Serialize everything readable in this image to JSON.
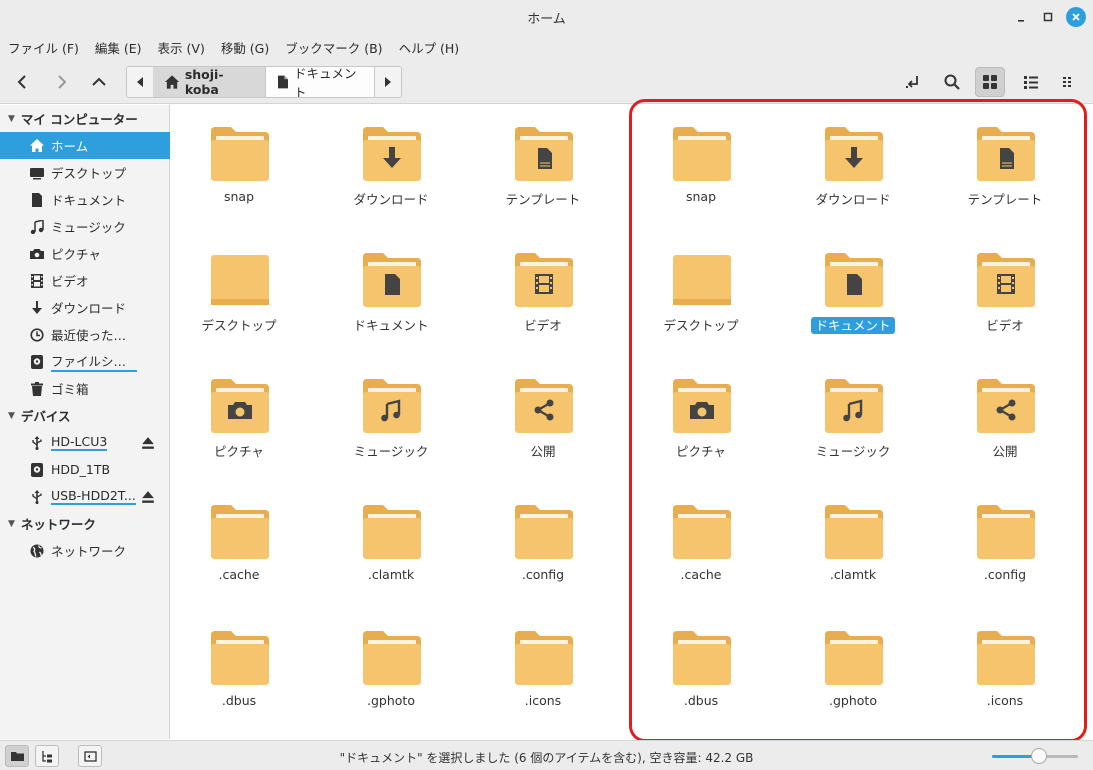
{
  "window": {
    "title": "ホーム"
  },
  "menu": [
    "ファイル (F)",
    "編集 (E)",
    "表示 (V)",
    "移動 (G)",
    "ブックマーク (B)",
    "ヘルプ (H)"
  ],
  "path": {
    "home": "shoji-koba",
    "doc": "ドキュメント"
  },
  "sidebar": {
    "sections": [
      {
        "title": "マイ コンピューター"
      },
      {
        "title": "デバイス"
      },
      {
        "title": "ネットワーク"
      }
    ],
    "computer": [
      {
        "label": "ホーム",
        "icon": "home-icon"
      },
      {
        "label": "デスクトップ",
        "icon": "desktop-icon"
      },
      {
        "label": "ドキュメント",
        "icon": "document-icon"
      },
      {
        "label": "ミュージック",
        "icon": "music-icon"
      },
      {
        "label": "ピクチャ",
        "icon": "camera-icon"
      },
      {
        "label": "ビデオ",
        "icon": "film-icon"
      },
      {
        "label": "ダウンロード",
        "icon": "download-icon"
      },
      {
        "label": "最近使ったフ...",
        "icon": "clock-icon"
      },
      {
        "label": "ファイルシス...",
        "icon": "drive-icon"
      },
      {
        "label": "ゴミ箱",
        "icon": "trash-icon"
      }
    ],
    "devices": [
      {
        "label": "HD-LCU3",
        "icon": "usb-icon"
      },
      {
        "label": "HDD_1TB",
        "icon": "drive-icon"
      },
      {
        "label": "USB-HDD2T...",
        "icon": "usb-icon"
      }
    ],
    "network": [
      {
        "label": "ネットワーク",
        "icon": "globe-icon"
      }
    ]
  },
  "files": [
    {
      "name": "snap",
      "emblem": ""
    },
    {
      "name": "ダウンロード",
      "emblem": "download"
    },
    {
      "name": "テンプレート",
      "emblem": "template"
    },
    {
      "name": "デスクトップ",
      "emblem": "desktop"
    },
    {
      "name": "ドキュメント",
      "emblem": "document"
    },
    {
      "name": "ビデオ",
      "emblem": "film"
    },
    {
      "name": "ピクチャ",
      "emblem": "camera"
    },
    {
      "name": "ミュージック",
      "emblem": "music"
    },
    {
      "name": "公開",
      "emblem": "share"
    },
    {
      "name": ".cache",
      "emblem": ""
    },
    {
      "name": ".clamtk",
      "emblem": ""
    },
    {
      "name": ".config",
      "emblem": ""
    },
    {
      "name": ".dbus",
      "emblem": ""
    },
    {
      "name": ".gphoto",
      "emblem": ""
    },
    {
      "name": ".icons",
      "emblem": ""
    }
  ],
  "status": {
    "text": "\"ドキュメント\" を選択しました (6 個のアイテムを含む), 空き容量: 42.2 GB"
  },
  "zoom": {
    "level": 0.55
  },
  "colors": {
    "accent": "#2e9fdc",
    "folder": "#f6c46d",
    "folderDark": "#e8ad4e",
    "highlight": "#e01e1e"
  }
}
